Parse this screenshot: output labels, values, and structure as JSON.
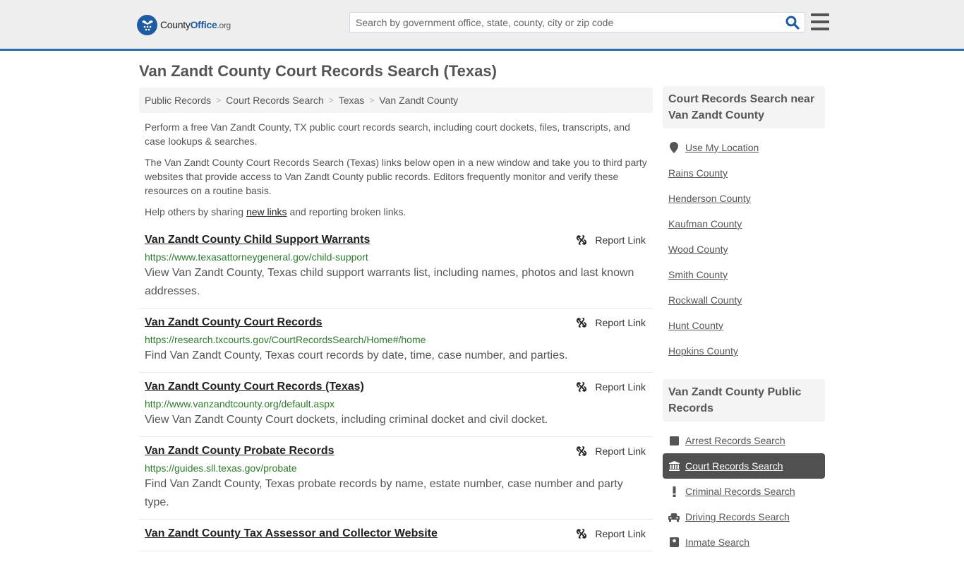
{
  "header": {
    "logo": {
      "county": "County",
      "office": "Office",
      "org": ".org"
    },
    "search": {
      "placeholder": "Search by government office, state, county, city or zip code",
      "value": ""
    },
    "colors": {
      "brand": "#1d5ca3",
      "accent_bar": "#2f6fa7",
      "header_bg": "#eeeeee"
    }
  },
  "page": {
    "title": "Van Zandt County Court Records Search (Texas)",
    "breadcrumb": [
      {
        "label": "Public Records"
      },
      {
        "label": "Court Records Search"
      },
      {
        "label": "Texas"
      },
      {
        "label": "Van Zandt County"
      }
    ],
    "intro": {
      "p1": "Perform a free Van Zandt County, TX public court records search, including court dockets, files, transcripts, and case lookups & searches.",
      "p2": "The Van Zandt County Court Records Search (Texas) links below open in a new window and take you to third party websites that provide access to Van Zandt County public records. Editors frequently monitor and verify these resources on a routine basis.",
      "p3_before": "Help others by sharing ",
      "p3_link": "new links",
      "p3_after": " and reporting broken links."
    }
  },
  "results": [
    {
      "title": "Van Zandt County Child Support Warrants",
      "url": "https://www.texasattorneygeneral.gov/child-support",
      "description": "View Van Zandt County, Texas child support warrants list, including names, photos and last known addresses.",
      "report_label": "Report Link"
    },
    {
      "title": "Van Zandt County Court Records",
      "url": "https://research.txcourts.gov/CourtRecordsSearch/Home#/home",
      "description": "Find Van Zandt County, Texas court records by date, time, case number, and parties.",
      "report_label": "Report Link"
    },
    {
      "title": "Van Zandt County Court Records (Texas)",
      "url": "http://www.vanzandtcounty.org/default.aspx",
      "description": "View Van Zandt County Court dockets, including criminal docket and civil docket.",
      "report_label": "Report Link"
    },
    {
      "title": "Van Zandt County Probate Records",
      "url": "https://guides.sll.texas.gov/probate",
      "description": "Find Van Zandt County, Texas probate records by name, estate number, case number and party type.",
      "report_label": "Report Link"
    },
    {
      "title": "Van Zandt County Tax Assessor and Collector Website",
      "url": "",
      "description": "",
      "report_label": "Report Link"
    }
  ],
  "sidebar": {
    "nearby": {
      "header": "Court Records Search near Van Zandt County",
      "use_location": {
        "label": "Use My Location",
        "icon": "map-marker-icon"
      },
      "items": [
        {
          "label": "Rains County"
        },
        {
          "label": "Henderson County"
        },
        {
          "label": "Kaufman County"
        },
        {
          "label": "Wood County"
        },
        {
          "label": "Smith County"
        },
        {
          "label": "Rockwall County"
        },
        {
          "label": "Hunt County"
        },
        {
          "label": "Hopkins County"
        }
      ]
    },
    "public_records": {
      "header": "Van Zandt County Public Records",
      "items": [
        {
          "label": "Arrest Records Search",
          "icon": "square-icon",
          "active": false
        },
        {
          "label": "Court Records Search",
          "icon": "courthouse-icon",
          "active": true
        },
        {
          "label": "Criminal Records Search",
          "icon": "exclamation-icon",
          "active": false
        },
        {
          "label": "Driving Records Search",
          "icon": "car-icon",
          "active": false
        },
        {
          "label": "Inmate Search",
          "icon": "inmate-icon",
          "active": false
        }
      ]
    }
  }
}
